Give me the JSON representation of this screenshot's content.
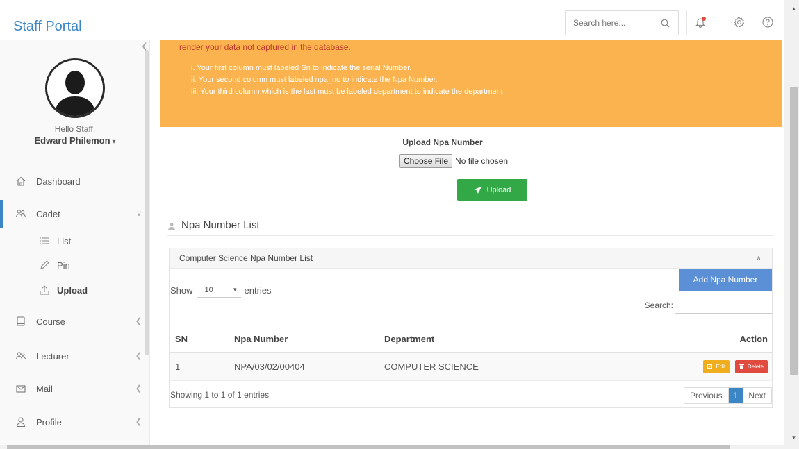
{
  "header": {
    "brand": "Staff Portal",
    "search_placeholder": "Search here...",
    "brand_color": "#3d86c6"
  },
  "sidebar": {
    "greeting": "Hello Staff,",
    "user_name": "Edward Philemon",
    "items": [
      {
        "label": "Dashboard",
        "icon": "home-icon"
      },
      {
        "label": "Cadet",
        "icon": "users-icon",
        "active": true
      },
      {
        "label": "Course",
        "icon": "book-icon"
      },
      {
        "label": "Lecturer",
        "icon": "users-icon"
      },
      {
        "label": "Mail",
        "icon": "mail-icon"
      },
      {
        "label": "Profile",
        "icon": "user-icon"
      }
    ],
    "sub_items": [
      {
        "label": "List",
        "icon": "list-icon"
      },
      {
        "label": "Pin",
        "icon": "pencil-icon"
      },
      {
        "label": "Upload",
        "icon": "upload-icon"
      }
    ]
  },
  "alert": {
    "line1": "render your data not captured in the database.",
    "rules": [
      "i. Your first column must labeled Sn to indicate the serial Number.",
      "ii. Your second column must labeled npa_no to indicate the Npa Number.",
      "iii. Your third column which is the last must be labeled department to indicate the department"
    ],
    "bg_color": "#fbb34f"
  },
  "upload": {
    "title": "Upload Npa Number",
    "choose_file_label": "Choose File",
    "no_file_text": "No file chosen",
    "button_label": "Upload"
  },
  "list": {
    "heading": "Npa Number List",
    "panel_title": "Computer Science Npa Number List",
    "add_button": "Add Npa Number",
    "show_label": "Show",
    "entries_value": "10",
    "entries_label": "entries",
    "search_label": "Search:",
    "columns": [
      "SN",
      "Npa Number",
      "Department",
      "Action"
    ],
    "rows": [
      {
        "sn": "1",
        "npa": "NPA/03/02/00404",
        "department": "COMPUTER SCIENCE",
        "edit": "Edit",
        "delete": "Delete"
      }
    ],
    "showing_text": "Showing 1 to 1 of 1 entries",
    "pager": {
      "prev": "Previous",
      "current": "1",
      "next": "Next"
    }
  }
}
